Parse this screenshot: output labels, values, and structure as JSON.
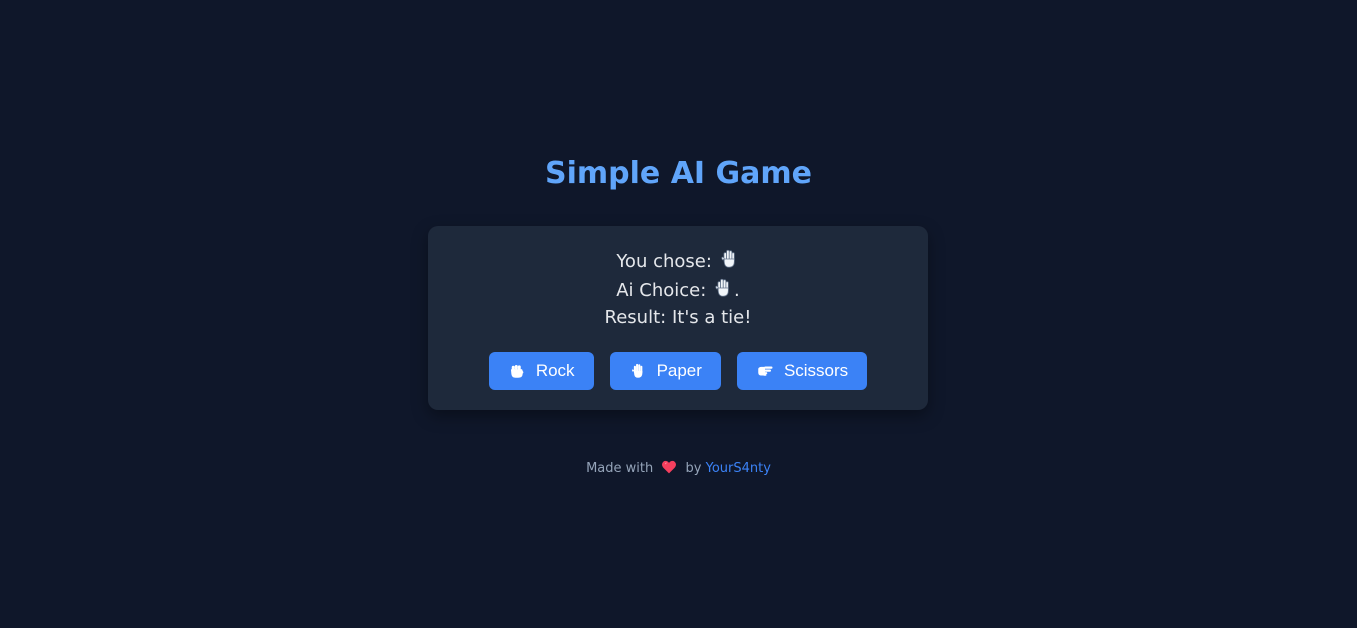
{
  "header": {
    "title": "Simple AI Game"
  },
  "game": {
    "you_chose_label": "You chose:",
    "you_chose_icon": "raised-hand-icon",
    "ai_choice_label": "Ai Choice:",
    "ai_choice_icon": "raised-hand-icon",
    "ai_choice_suffix": ".",
    "result_label": "Result:",
    "result_text": "It's a tie!"
  },
  "buttons": [
    {
      "label": "Rock",
      "icon": "fist-icon"
    },
    {
      "label": "Paper",
      "icon": "raised-hand-icon"
    },
    {
      "label": "Scissors",
      "icon": "pointing-hand-icon"
    }
  ],
  "footer": {
    "made_with": "Made with",
    "heart_icon": "heart-icon",
    "by": "by",
    "author": "YourS4nty"
  },
  "colors": {
    "background": "#0f172a",
    "card": "#1e293b",
    "accent": "#3b82f6",
    "title": "#60a5fa",
    "heart": "#f43f5e"
  }
}
